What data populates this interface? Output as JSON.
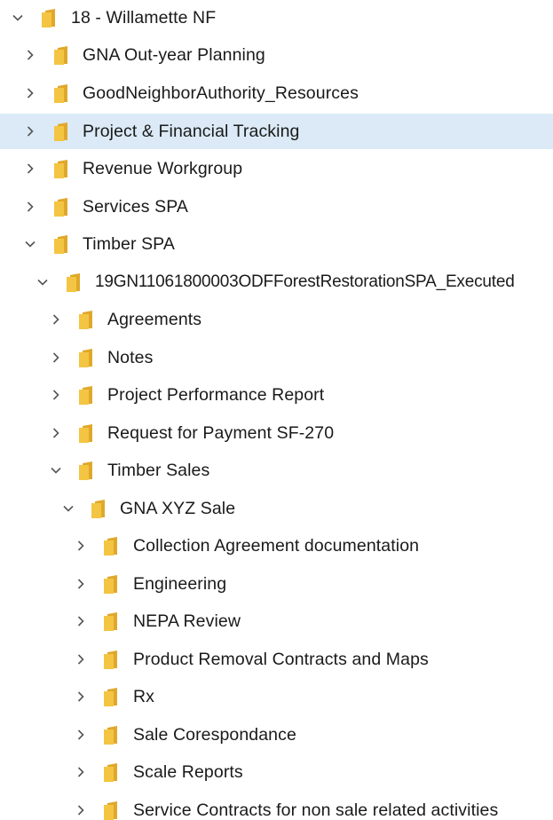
{
  "tree": {
    "items": [
      {
        "label": "18 - Willamette NF",
        "expanded": true,
        "selected": false,
        "icon": "folder-icon"
      },
      {
        "label": "GNA Out-year Planning",
        "expanded": false,
        "selected": false,
        "icon": "folder-icon"
      },
      {
        "label": "GoodNeighborAuthority_Resources",
        "expanded": false,
        "selected": false,
        "icon": "folder-icon"
      },
      {
        "label": "Project & Financial Tracking",
        "expanded": false,
        "selected": true,
        "icon": "folder-icon"
      },
      {
        "label": "Revenue Workgroup",
        "expanded": false,
        "selected": false,
        "icon": "folder-icon"
      },
      {
        "label": "Services SPA",
        "expanded": false,
        "selected": false,
        "icon": "folder-icon"
      },
      {
        "label": "Timber SPA",
        "expanded": true,
        "selected": false,
        "icon": "folder-icon"
      },
      {
        "label": "19GN11061800003ODFForestRestorationSPA_Executed",
        "expanded": true,
        "selected": false,
        "icon": "folder-icon"
      },
      {
        "label": "Agreements",
        "expanded": false,
        "selected": false,
        "icon": "folder-icon"
      },
      {
        "label": "Notes",
        "expanded": false,
        "selected": false,
        "icon": "folder-icon"
      },
      {
        "label": "Project Performance Report",
        "expanded": false,
        "selected": false,
        "icon": "folder-icon"
      },
      {
        "label": "Request for Payment SF-270",
        "expanded": false,
        "selected": false,
        "icon": "folder-icon"
      },
      {
        "label": "Timber Sales",
        "expanded": true,
        "selected": false,
        "icon": "folder-icon"
      },
      {
        "label": "GNA XYZ Sale",
        "expanded": true,
        "selected": false,
        "icon": "folder-icon"
      },
      {
        "label": "Collection Agreement documentation",
        "expanded": false,
        "selected": false,
        "icon": "folder-icon"
      },
      {
        "label": "Engineering",
        "expanded": false,
        "selected": false,
        "icon": "folder-icon"
      },
      {
        "label": "NEPA Review",
        "expanded": false,
        "selected": false,
        "icon": "folder-icon"
      },
      {
        "label": "Product Removal Contracts and Maps",
        "expanded": false,
        "selected": false,
        "icon": "folder-icon"
      },
      {
        "label": "Rx",
        "expanded": false,
        "selected": false,
        "icon": "folder-icon"
      },
      {
        "label": "Sale Corespondance",
        "expanded": false,
        "selected": false,
        "icon": "folder-icon"
      },
      {
        "label": "Scale Reports",
        "expanded": false,
        "selected": false,
        "icon": "folder-icon"
      },
      {
        "label": "Service Contracts for non sale related activities",
        "expanded": false,
        "selected": false,
        "icon": "folder-icon"
      }
    ]
  },
  "colors": {
    "selection": "#dbeaf6",
    "folder_front": "#f4c542",
    "folder_back": "#e0a82b",
    "chevron": "#555555"
  }
}
